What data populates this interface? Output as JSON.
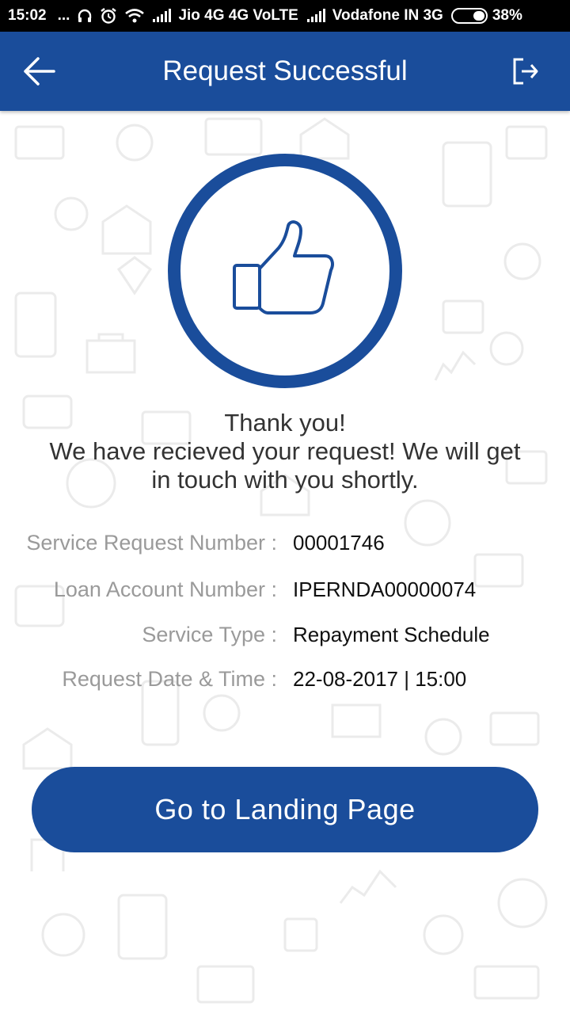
{
  "status_bar": {
    "time": "15:02",
    "dots": "...",
    "carrier1": "Jio 4G 4G VoLTE",
    "carrier2": "Vodafone IN 3G",
    "battery": "38%",
    "icons": [
      "headphones-icon",
      "alarm-icon",
      "wifi-icon",
      "signal-icon",
      "battery-icon"
    ]
  },
  "app_bar": {
    "title": "Request Successful",
    "back_icon": "back-arrow-icon",
    "logout_icon": "logout-icon",
    "color": "#1a4d9b"
  },
  "success": {
    "icon": "thumbs-up-icon",
    "line1": "Thank you!",
    "line2": "We have recieved your request! We will get",
    "line3": "in touch with you shortly."
  },
  "details": [
    {
      "label": "Service Request Number :",
      "value": "00001746"
    },
    {
      "label": "Loan Account Number :",
      "value": "IPERNDA00000074"
    },
    {
      "label": "Service Type :",
      "value": "Repayment Schedule"
    },
    {
      "label": "Request Date & Time :",
      "value": "22-08-2017 | 15:00"
    }
  ],
  "cta": {
    "label": "Go to Landing Page"
  }
}
